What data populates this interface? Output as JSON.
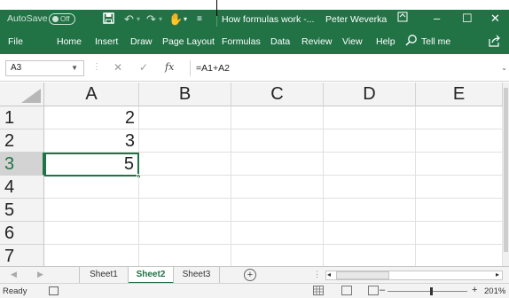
{
  "titlebar": {
    "autosave_label": "AutoSave",
    "autosave_state": "Off",
    "doc_title": "How formulas work -...",
    "user_name": "Peter Weverka"
  },
  "ribbon": {
    "tabs": [
      "File",
      "Home",
      "Insert",
      "Draw",
      "Page Layout",
      "Formulas",
      "Data",
      "Review",
      "View",
      "Help"
    ],
    "tell_me": "Tell me"
  },
  "formula_bar": {
    "name_box": "A3",
    "fx": "fx",
    "formula": "=A1+A2"
  },
  "grid": {
    "columns": [
      "A",
      "B",
      "C",
      "D",
      "E"
    ],
    "rows": [
      "1",
      "2",
      "3",
      "4",
      "5",
      "6",
      "7"
    ],
    "values": {
      "A1": "2",
      "A2": "3",
      "A3": "5"
    },
    "selected_cell": "A3"
  },
  "sheets": [
    "Sheet1",
    "Sheet2",
    "Sheet3"
  ],
  "active_sheet": "Sheet2",
  "status": {
    "ready": "Ready",
    "zoom": "201%"
  },
  "colors": {
    "accent": "#217346"
  }
}
